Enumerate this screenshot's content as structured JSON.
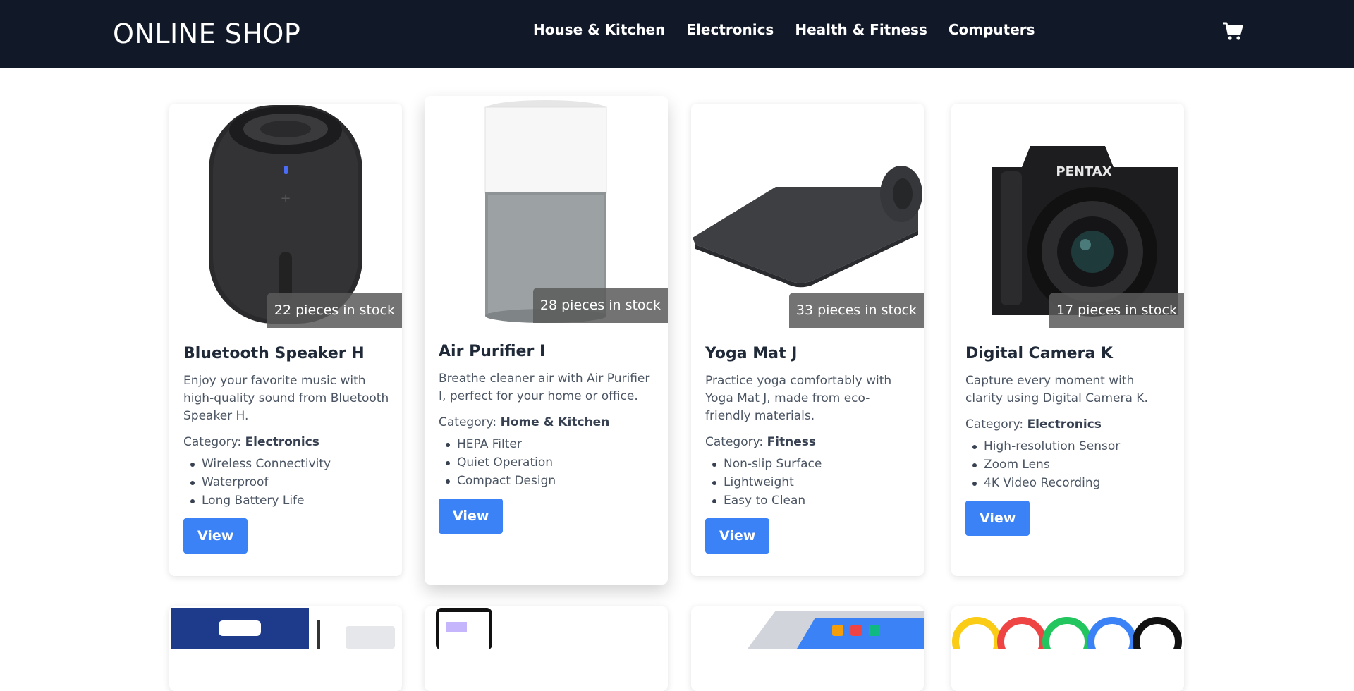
{
  "header": {
    "brand": "ONLINE SHOP",
    "nav": [
      "House & Kitchen",
      "Electronics",
      "Health & Fitness",
      "Computers"
    ],
    "cart_icon": "cart-icon"
  },
  "colors": {
    "navbar": "#111827",
    "accent": "#3b82f6",
    "stock_badge": "#5a5a5a"
  },
  "products": [
    {
      "title": "Bluetooth Speaker H",
      "stock": "22 pieces in stock",
      "description": "Enjoy your favorite music with high-quality sound from Bluetooth Speaker H.",
      "category_label": "Category:",
      "category": "Electronics",
      "features": [
        "Wireless Connectivity",
        "Waterproof",
        "Long Battery Life"
      ],
      "button": "View",
      "image": "speaker-image"
    },
    {
      "title": "Air Purifier I",
      "stock": "28 pieces in stock",
      "description": "Breathe cleaner air with Air Purifier I, perfect for your home or office.",
      "category_label": "Category:",
      "category": "Home & Kitchen",
      "features": [
        "HEPA Filter",
        "Quiet Operation",
        "Compact Design"
      ],
      "button": "View",
      "image": "air-purifier-image"
    },
    {
      "title": "Yoga Mat J",
      "stock": "33 pieces in stock",
      "description": "Practice yoga comfortably with Yoga Mat J, made from eco-friendly materials.",
      "category_label": "Category:",
      "category": "Fitness",
      "features": [
        "Non-slip Surface",
        "Lightweight",
        "Easy to Clean"
      ],
      "button": "View",
      "image": "yoga-mat-image"
    },
    {
      "title": "Digital Camera K",
      "stock": "17 pieces in stock",
      "description": "Capture every moment with clarity using Digital Camera K.",
      "category_label": "Category:",
      "category": "Electronics",
      "features": [
        "High-resolution Sensor",
        "Zoom Lens",
        "4K Video Recording"
      ],
      "button": "View",
      "image": "camera-image",
      "brand_text": "PENTAX"
    }
  ],
  "second_row": [
    "toothbrush-image",
    "phone-app-image",
    "tablet-image",
    "cables-image"
  ]
}
